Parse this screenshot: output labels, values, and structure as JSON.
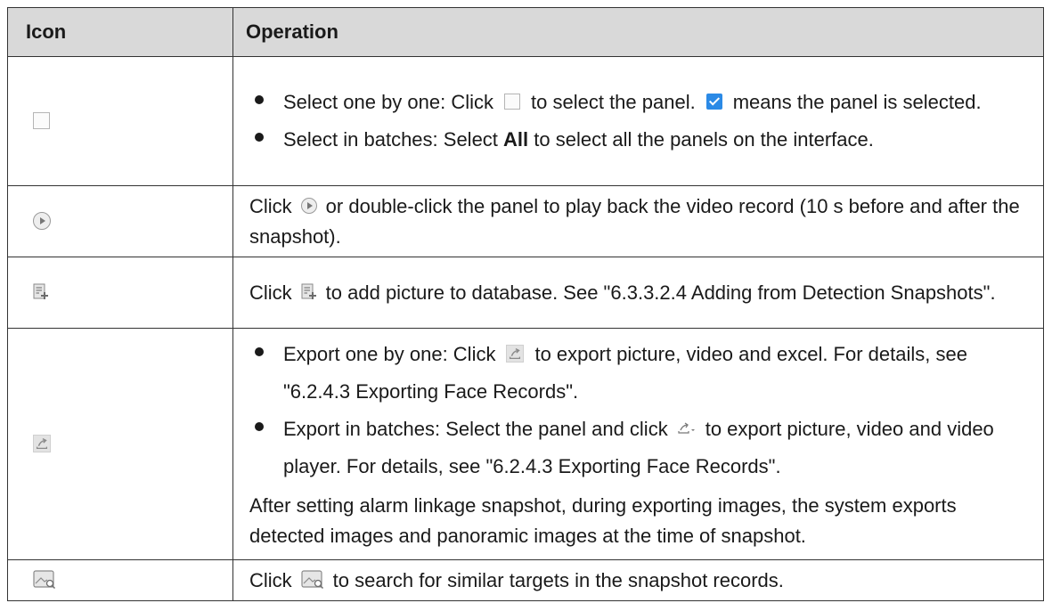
{
  "table": {
    "headers": {
      "icon": "Icon",
      "operation": "Operation"
    },
    "rows": [
      {
        "icon_name": "checkbox-icon",
        "bullets": [
          {
            "parts": [
              "Select one by one: Click",
              "to select the panel.",
              "means the panel is selected."
            ]
          },
          {
            "prefix": "Select in batches: Select",
            "bold": "All",
            "suffix": "to select all the panels on the interface."
          }
        ]
      },
      {
        "icon_name": "play-icon",
        "text_before": "Click",
        "text_after": "or double-click the panel to play back the video record (10 s before and after the snapshot)."
      },
      {
        "icon_name": "add-to-database-icon",
        "text_before": "Click",
        "text_after": "to add picture to database. See \"6.3.3.2.4 Adding from Detection Snapshots\"."
      },
      {
        "icon_name": "export-icon",
        "bullets": [
          {
            "before": "Export one by one: Click",
            "after": "to export picture, video and excel. For details, see \"6.2.4.3 Exporting Face Records\"."
          },
          {
            "before": "Export in batches: Select the panel and click",
            "after": "to export picture, video and video player. For details, see \"6.2.4.3 Exporting Face Records\"."
          }
        ],
        "note": "After setting alarm linkage snapshot, during exporting images, the system exports detected images and panoramic images at the time of snapshot."
      },
      {
        "icon_name": "search-similar-icon",
        "text_before": "Click",
        "text_after": "to search for similar targets in the snapshot records."
      }
    ]
  },
  "colors": {
    "header_bg": "#d9d9d9",
    "border": "#333333",
    "checked_blue": "#2b8ae6"
  }
}
